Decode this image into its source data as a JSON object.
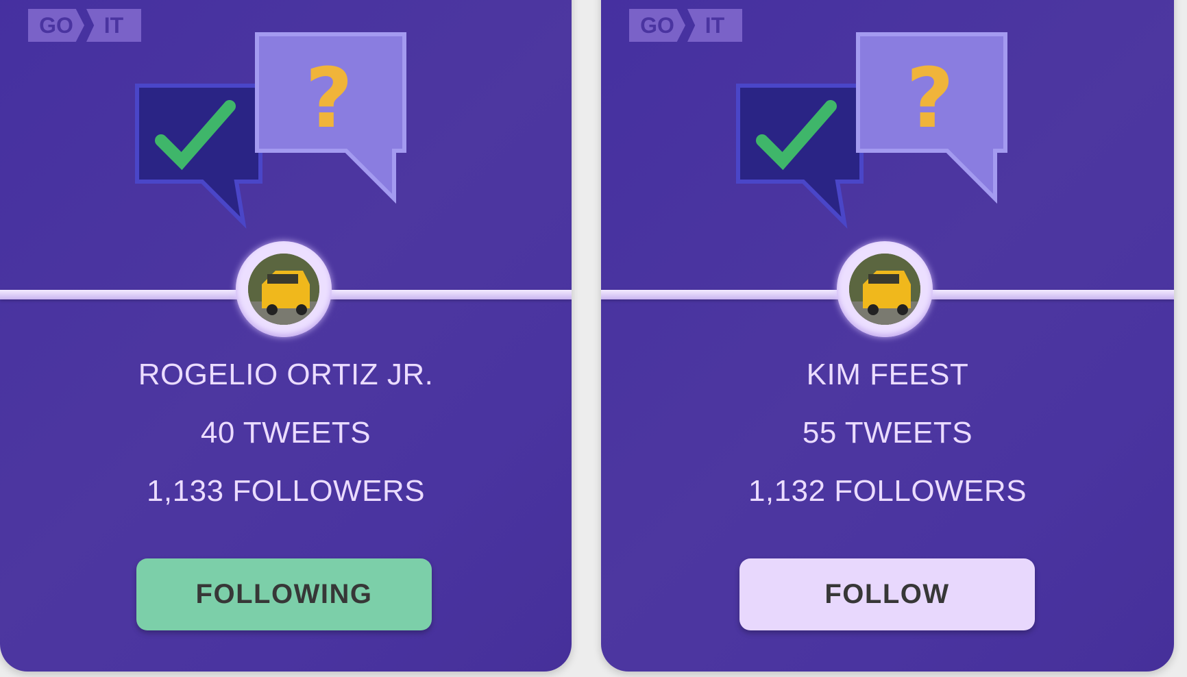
{
  "logo": {
    "left": "GO",
    "right": "IT"
  },
  "cards": [
    {
      "name": "ROGELIO ORTIZ JR.",
      "tweets": "40 TWEETS",
      "followers": "1,133 FOLLOWERS",
      "button": "FOLLOWING",
      "button_color": "#7ccfa9",
      "state": "following"
    },
    {
      "name": "KIM FEEST",
      "tweets": "55 TWEETS",
      "followers": "1,132 FOLLOWERS",
      "button": "FOLLOW",
      "button_color": "#e8d8fd",
      "state": "not-following"
    }
  ],
  "colors": {
    "card_bg": "#4a34a0",
    "text": "#ebdcff",
    "page_bg": "#ededed"
  },
  "icons": [
    "checkmark-bubble-icon",
    "question-bubble-icon",
    "avatar-car-photo"
  ]
}
